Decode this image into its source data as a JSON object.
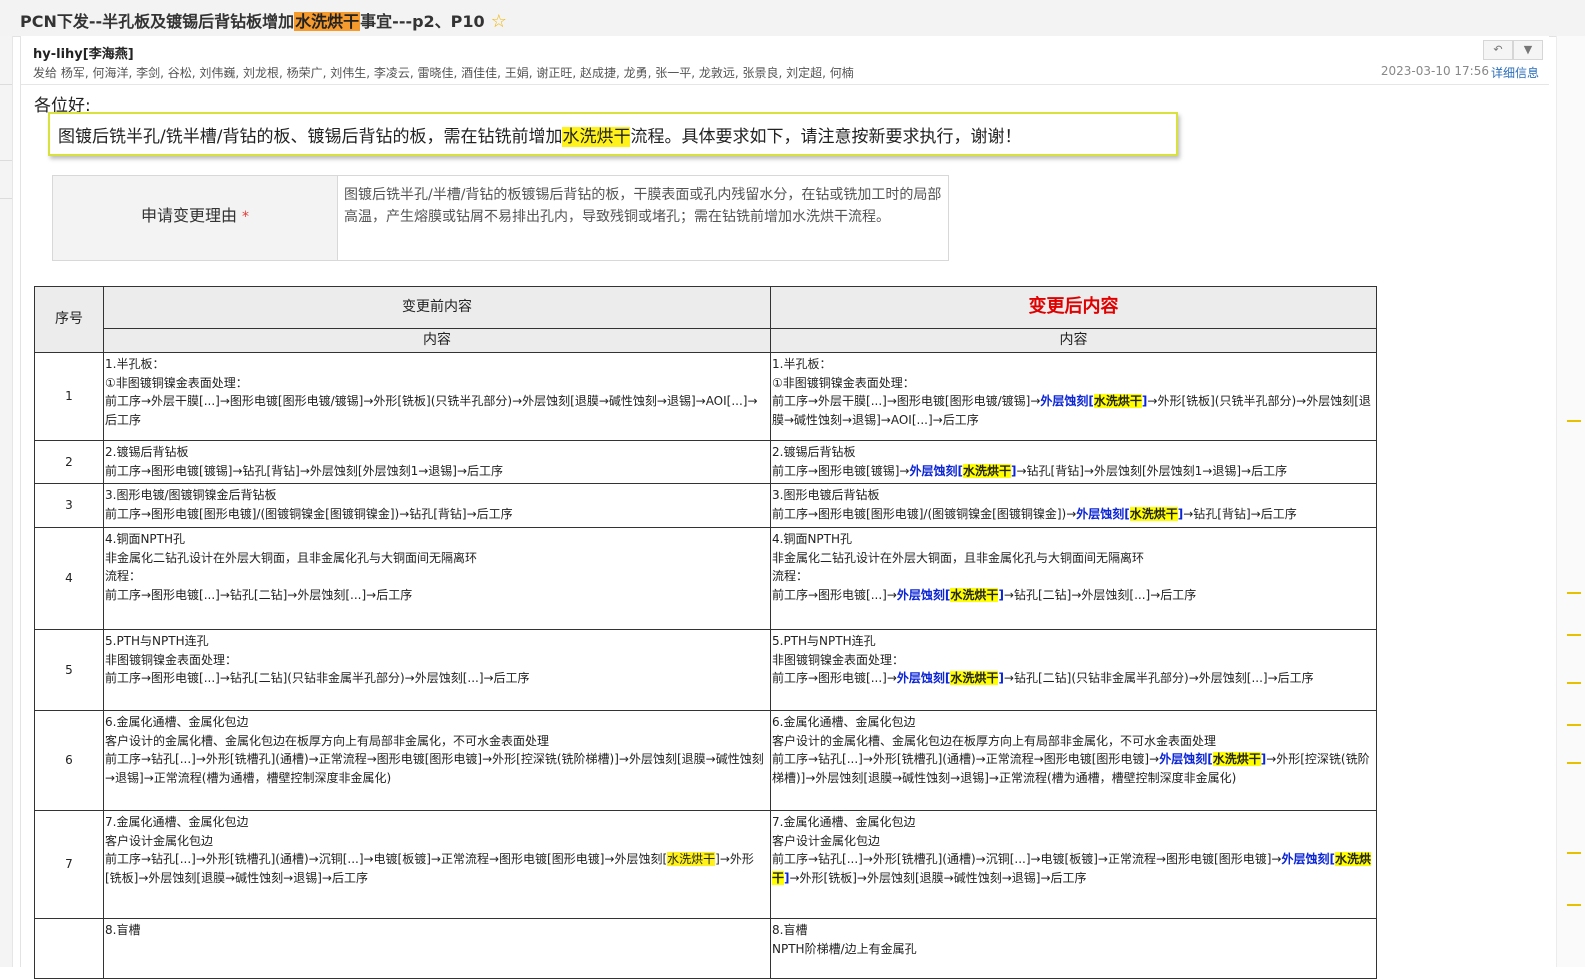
{
  "window": {
    "title_pre": "PCN下发--半孔板及镀锡后背钻板增加",
    "title_hl": "水洗烘干",
    "title_post": "事宜---p2、P10",
    "star": "☆"
  },
  "mail": {
    "sender": "hy-lihy[李海燕]",
    "recipients": "发给 杨军, 何海洋, 李剑, 谷松, 刘伟巍, 刘龙根, 杨荣广, 刘伟生, 李凌云, 雷晓佳, 酒佳佳, 王娟, 谢正旺, 赵成捷, 龙勇, 张一平, 龙敦远, 张景良, 刘定超, 何楠",
    "date": "2023-03-10 17:56",
    "detail_link": "详细信息",
    "reply_icon": "↶",
    "more_icon": "▼",
    "greeting": "各位好:"
  },
  "notice": {
    "pre": "图镀后铣半孔/铣半槽/背钻的板、镀锡后背钻的板，需在钻铣前增加",
    "hl": "水洗烘干",
    "post": "流程。具体要求如下，请注意按新要求执行，谢谢！"
  },
  "reason": {
    "label": "申请变更理由",
    "required_mark": "*",
    "text": "图镀后铣半孔/半槽/背钻的板镀锡后背钻的板，干膜表面或孔内残留水分，在钻或铣加工时的局部高温，产生熔膜或钻屑不易排出孔内，导致残铜或堵孔；需在钻铣前增加水洗烘干流程。"
  },
  "table": {
    "col_seq": "序号",
    "col_before": "变更前内容",
    "col_after": "变更后内容",
    "sub_before": "内容",
    "sub_after": "内容",
    "rows": [
      {
        "seq": "1",
        "before": [
          [
            {
              "t": "1.半孔板："
            }
          ],
          [
            {
              "t": "①非图镀铜镍金表面处理："
            }
          ],
          [
            {
              "t": "前工序→外层干膜[...]→图形电镀[图形电镀/镀锡]→外形[铣板](只铣半孔部分)→外层蚀刻[退膜→碱性蚀刻→退锡]→AOI[...]→后工序"
            }
          ]
        ],
        "after": [
          [
            {
              "t": "1.半孔板："
            }
          ],
          [
            {
              "t": "①非图镀铜镍金表面处理："
            }
          ],
          [
            {
              "t": "前工序→外层干膜[...]→图形电镀[图形电镀/镀锡]→"
            },
            {
              "t": "外层蚀刻[",
              "s": "b"
            },
            {
              "t": "水洗烘干",
              "s": "y"
            },
            {
              "t": "]",
              "s": "b"
            },
            {
              "t": "→外形[铣板](只铣半孔部分)→外层蚀刻[退膜→碱性蚀刻→退锡]→AOI[...]→后工序"
            }
          ]
        ]
      },
      {
        "seq": "2",
        "before": [
          [
            {
              "t": "2.镀锡后背钻板"
            }
          ],
          [
            {
              "t": "前工序→图形电镀[镀锡]→钻孔[背钻]→外层蚀刻[外层蚀刻1→退锡]→后工序"
            }
          ]
        ],
        "after": [
          [
            {
              "t": "2.镀锡后背钻板"
            }
          ],
          [
            {
              "t": "前工序→图形电镀[镀锡]→"
            },
            {
              "t": "外层蚀刻[",
              "s": "b"
            },
            {
              "t": "水洗烘干",
              "s": "y"
            },
            {
              "t": "]",
              "s": "b"
            },
            {
              "t": "→钻孔[背钻]→外层蚀刻[外层蚀刻1→退锡]→后工序"
            }
          ]
        ]
      },
      {
        "seq": "3",
        "before": [
          [
            {
              "t": "3.图形电镀/图镀铜镍金后背钻板"
            }
          ],
          [
            {
              "t": "前工序→图形电镀[图形电镀]/(图镀铜镍金[图镀铜镍金])→钻孔[背钻]→后工序"
            }
          ]
        ],
        "after": [
          [
            {
              "t": "3.图形电镀后背钻板"
            }
          ],
          [
            {
              "t": "前工序→图形电镀[图形电镀]/(图镀铜镍金[图镀铜镍金])→"
            },
            {
              "t": "外层蚀刻[",
              "s": "b"
            },
            {
              "t": "水洗烘干",
              "s": "y"
            },
            {
              "t": "]",
              "s": "b"
            },
            {
              "t": "→钻孔[背钻]→后工序"
            }
          ]
        ]
      },
      {
        "seq": "4",
        "before": [
          [
            {
              "t": "4.铜面NPTH孔"
            }
          ],
          [
            {
              "t": "非金属化二钻孔设计在外层大铜面，且非金属化孔与大铜面间无隔离环"
            }
          ],
          [
            {
              "t": "流程："
            }
          ],
          [
            {
              "t": "前工序→图形电镀[...]→钻孔[二钻]→外层蚀刻[...]→后工序"
            }
          ]
        ],
        "after": [
          [
            {
              "t": "4.铜面NPTH孔"
            }
          ],
          [
            {
              "t": "非金属化二钻孔设计在外层大铜面，且非金属化孔与大铜面间无隔离环"
            }
          ],
          [
            {
              "t": "流程："
            }
          ],
          [
            {
              "t": "前工序→图形电镀[...]→"
            },
            {
              "t": "外层蚀刻[",
              "s": "b"
            },
            {
              "t": "水洗烘干",
              "s": "y"
            },
            {
              "t": "]",
              "s": "b"
            },
            {
              "t": "→钻孔[二钻]→外层蚀刻[...]→后工序"
            }
          ]
        ]
      },
      {
        "seq": "5",
        "before": [
          [
            {
              "t": "5.PTH与NPTH连孔"
            }
          ],
          [
            {
              "t": "非图镀铜镍金表面处理："
            }
          ],
          [
            {
              "t": "前工序→图形电镀[...]→钻孔[二钻](只钻非金属半孔部分)→外层蚀刻[...]→后工序"
            }
          ]
        ],
        "after": [
          [
            {
              "t": "5.PTH与NPTH连孔"
            }
          ],
          [
            {
              "t": "非图镀铜镍金表面处理："
            }
          ],
          [
            {
              "t": "前工序→图形电镀[...]→"
            },
            {
              "t": "外层蚀刻[",
              "s": "b"
            },
            {
              "t": "水洗烘干",
              "s": "y"
            },
            {
              "t": "]",
              "s": "b"
            },
            {
              "t": "→钻孔[二钻](只钻非金属半孔部分)→外层蚀刻[...]→后工序"
            }
          ]
        ]
      },
      {
        "seq": "6",
        "before": [
          [
            {
              "t": "6.金属化通槽、金属化包边"
            }
          ],
          [
            {
              "t": "客户设计的金属化槽、金属化包边在板厚方向上有局部非金属化，不可水金表面处理"
            }
          ],
          [
            {
              "t": "前工序→钻孔[...]→外形[铣槽孔](通槽)→正常流程→图形电镀[图形电镀]→外形[控深铣(铣阶梯槽)]→外层蚀刻[退膜→碱性蚀刻→退锡]→正常流程(槽为通槽，槽壁控制深度非金属化)"
            }
          ]
        ],
        "after": [
          [
            {
              "t": "6.金属化通槽、金属化包边"
            }
          ],
          [
            {
              "t": "客户设计的金属化槽、金属化包边在板厚方向上有局部非金属化，不可水金表面处理"
            }
          ],
          [
            {
              "t": "前工序→钻孔[...]→外形[铣槽孔](通槽)→正常流程→图形电镀[图形电镀]→"
            },
            {
              "t": "外层蚀刻[",
              "s": "b"
            },
            {
              "t": "水洗烘干",
              "s": "y"
            },
            {
              "t": "]",
              "s": "b"
            },
            {
              "t": "→外形[控深铣(铣阶梯槽)]→外层蚀刻[退膜→碱性蚀刻→退锡]→正常流程(槽为通槽，槽壁控制深度非金属化)"
            }
          ]
        ]
      },
      {
        "seq": "7",
        "before": [
          [
            {
              "t": "7.金属化通槽、金属化包边"
            }
          ],
          [
            {
              "t": "客户设计金属化包边"
            }
          ],
          [
            {
              "t": "前工序→钻孔[...]→外形[铣槽孔](通槽)→沉铜[...]→电镀[板镀]→正常流程→图形电镀[图形电镀]→外层蚀刻["
            },
            {
              "t": "水洗烘干",
              "s": "yn"
            },
            {
              "t": "]→外形[铣板]→外层蚀刻[退膜→碱性蚀刻→退锡]→后工序"
            }
          ]
        ],
        "after": [
          [
            {
              "t": "7.金属化通槽、金属化包边"
            }
          ],
          [
            {
              "t": "客户设计金属化包边"
            }
          ],
          [
            {
              "t": "前工序→钻孔[...]→外形[铣槽孔](通槽)→沉铜[...]→电镀[板镀]→正常流程→图形电镀[图形电镀]→"
            },
            {
              "t": "外层蚀刻[",
              "s": "b"
            },
            {
              "t": "水洗烘干",
              "s": "y"
            },
            {
              "t": "]",
              "s": "b"
            },
            {
              "t": "→外形[铣板]→外层蚀刻[退膜→碱性蚀刻→退锡]→后工序"
            }
          ]
        ]
      },
      {
        "seq": "",
        "before": [
          [
            {
              "t": "8.盲槽"
            }
          ]
        ],
        "after": [
          [
            {
              "t": "8.盲槽"
            }
          ],
          [
            {
              "t": "NPTH阶梯槽/边上有金属孔"
            }
          ]
        ]
      }
    ]
  }
}
